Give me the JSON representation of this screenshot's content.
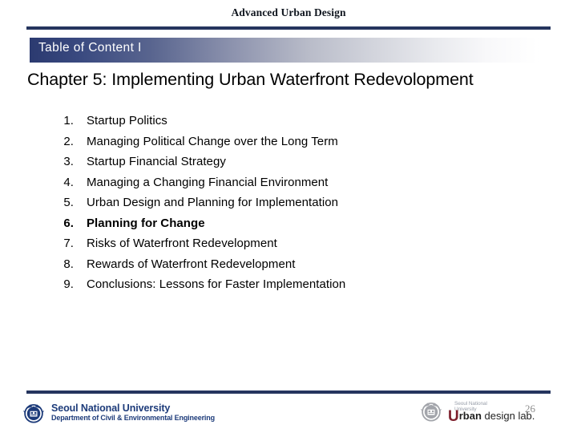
{
  "slide": {
    "header_title": "Advanced Urban Design",
    "section_band_label": "Table of Content I",
    "chapter_heading": "Chapter 5: Implementing Urban Waterfront Redevolopment"
  },
  "toc": {
    "items": [
      {
        "number": "1.",
        "label": "Startup Politics",
        "bold": false
      },
      {
        "number": "2.",
        "label": "Managing Political Change over the Long Term",
        "bold": false
      },
      {
        "number": "3.",
        "label": "Startup Financial Strategy",
        "bold": false
      },
      {
        "number": "4.",
        "label": "Managing a Changing Financial Environment",
        "bold": false
      },
      {
        "number": "5.",
        "label": "Urban Design and Planning for Implementation",
        "bold": false
      },
      {
        "number": "6.",
        "label": "Planning for Change",
        "bold": true
      },
      {
        "number": "7.",
        "label": "Risks of Waterfront Redevelopment",
        "bold": false
      },
      {
        "number": "8.",
        "label": "Rewards of Waterfront Redevelopment",
        "bold": false
      },
      {
        "number": "9.",
        "label": "Conclusions: Lessons for Faster Implementation",
        "bold": false
      }
    ]
  },
  "footer": {
    "university_name": "Seoul National University",
    "department": "Department of Civil & Environmental Engineering",
    "lab_small_line1": "Seoul National",
    "lab_small_line2": "University",
    "lab_initial": "U",
    "lab_word": "rban",
    "lab_tail": " design lab.",
    "page_number": "26"
  },
  "colors": {
    "rule_navy": "#25355e",
    "band_start": "#2b3a70",
    "snu_blue": "#1d3b7a",
    "lab_maroon": "#7d1f2c",
    "page_number_gray": "#8c8c8c"
  }
}
